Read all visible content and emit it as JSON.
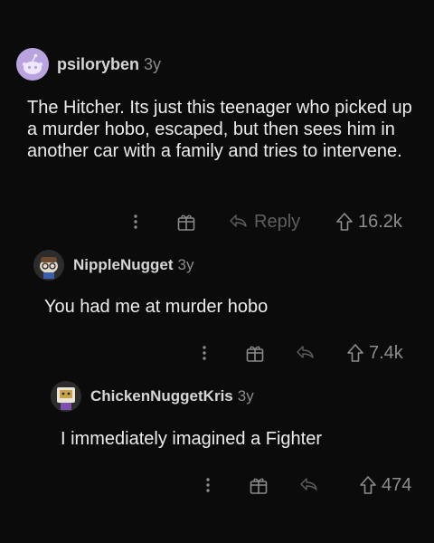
{
  "comments": [
    {
      "username": "psiloryben",
      "age": "3y",
      "body": "The Hitcher. Its just this teenager who picked up a murder hobo, escaped, but then sees him in another car with a family and tries to intervene.",
      "reply_label": "Reply",
      "score": "16.2k"
    },
    {
      "username": "NippleNugget",
      "age": "3y",
      "body": "You had me at murder hobo",
      "score": "7.4k"
    },
    {
      "username": "ChickenNuggetKris",
      "age": "3y",
      "body": "I immediately imagined a Fighter",
      "score": "474"
    }
  ],
  "icons": {
    "more": "more-vertical-icon",
    "award": "award-gift-icon",
    "reply": "reply-arrow-icon",
    "upvote": "upvote-arrow-icon"
  },
  "colors": {
    "background": "#0b0b0b",
    "text": "#ececec",
    "muted": "#8b8b8b",
    "avatar_1": "#b9a4e0"
  }
}
